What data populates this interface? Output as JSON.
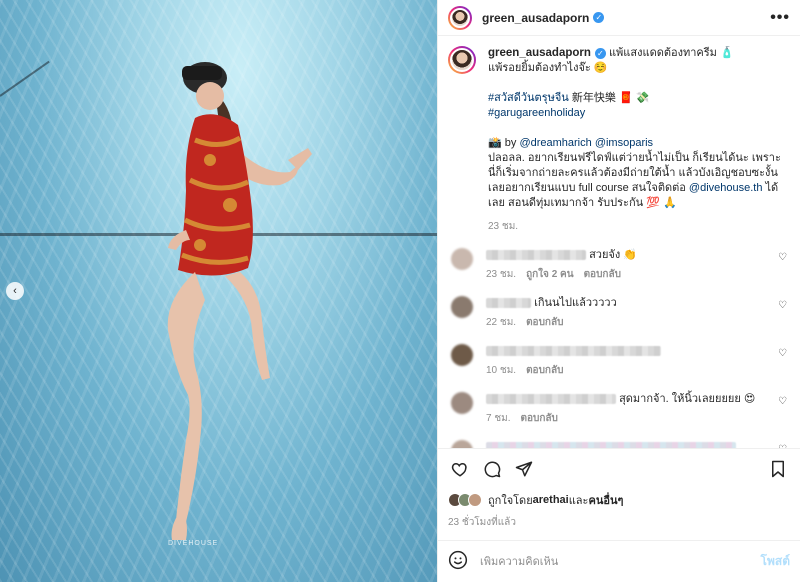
{
  "photo": {
    "signature": "DIVEHOUSE"
  },
  "header": {
    "username": "green_ausadaporn",
    "more_label": "•••"
  },
  "caption": {
    "username": "green_ausadaporn",
    "line1": "แพ้แสงแดดต้องทาครีม 🧴",
    "line2": "แพ้รอยยิ้มต้องทำไงจ๊ะ ☺️",
    "hashtag1": "#สวัสดีวันตรุษจีน",
    "hashtag1_suffix": " 新年快樂 🧧 💸",
    "hashtag2": "#garugareenholiday",
    "credit_prefix": "📸 by ",
    "credit_user1": "@dreamharich",
    "credit_user2": "@imsoparis",
    "body1": "ปลอลล. อยากเรียนฟรีไดฟ์แต่ว่ายน้ำไม่เป็น ก็เรียนได้นะ เพราะนี่ก็เริ่มจากถ่ายละครแล้วต้องมีถ่ายใต้น้ำ แล้วบังเอิญชอบซะงั้นเลยอยากเรียนแบบ full course สนใจติดต่อ ",
    "body_user": "@divehouse.th",
    "body2": " ได้เลย สอนดีทุ่มเทมากจ้า รับประกัน 💯 🙏",
    "time": "23 ชม."
  },
  "comments": [
    {
      "text": "สวยจัง 👏",
      "time": "23 ชม.",
      "likes": "ถูกใจ 2 คน",
      "reply": "ตอบกลับ",
      "avatar_color": "#c9b8ae"
    },
    {
      "text": "เกินนไปแล้ววววว",
      "time": "22 ชม.",
      "likes": "",
      "reply": "ตอบกลับ",
      "avatar_color": "#8a7a6e"
    },
    {
      "text": "",
      "time": "10 ชม.",
      "likes": "",
      "reply": "ตอบกลับ",
      "avatar_color": "#6e5a48"
    },
    {
      "text": "สุดมากจ้า. ให้นิ้วเลยยยยย 😍",
      "time": "7 ชม.",
      "likes": "",
      "reply": "ตอบกลับ",
      "avatar_color": "#9c8a80"
    },
    {
      "text": "",
      "time": "",
      "likes": "",
      "reply": "",
      "avatar_color": "#b9a69a"
    }
  ],
  "likes": {
    "prefix": "ถูกใจโดย ",
    "user": "arethai",
    "suffix": " และ",
    "others": "คนอื่นๆ"
  },
  "post_time": "23 ชั่วโมงที่แล้ว",
  "add_comment": {
    "placeholder": "เพิ่มความคิดเห็น",
    "post_label": "โพสต์"
  }
}
